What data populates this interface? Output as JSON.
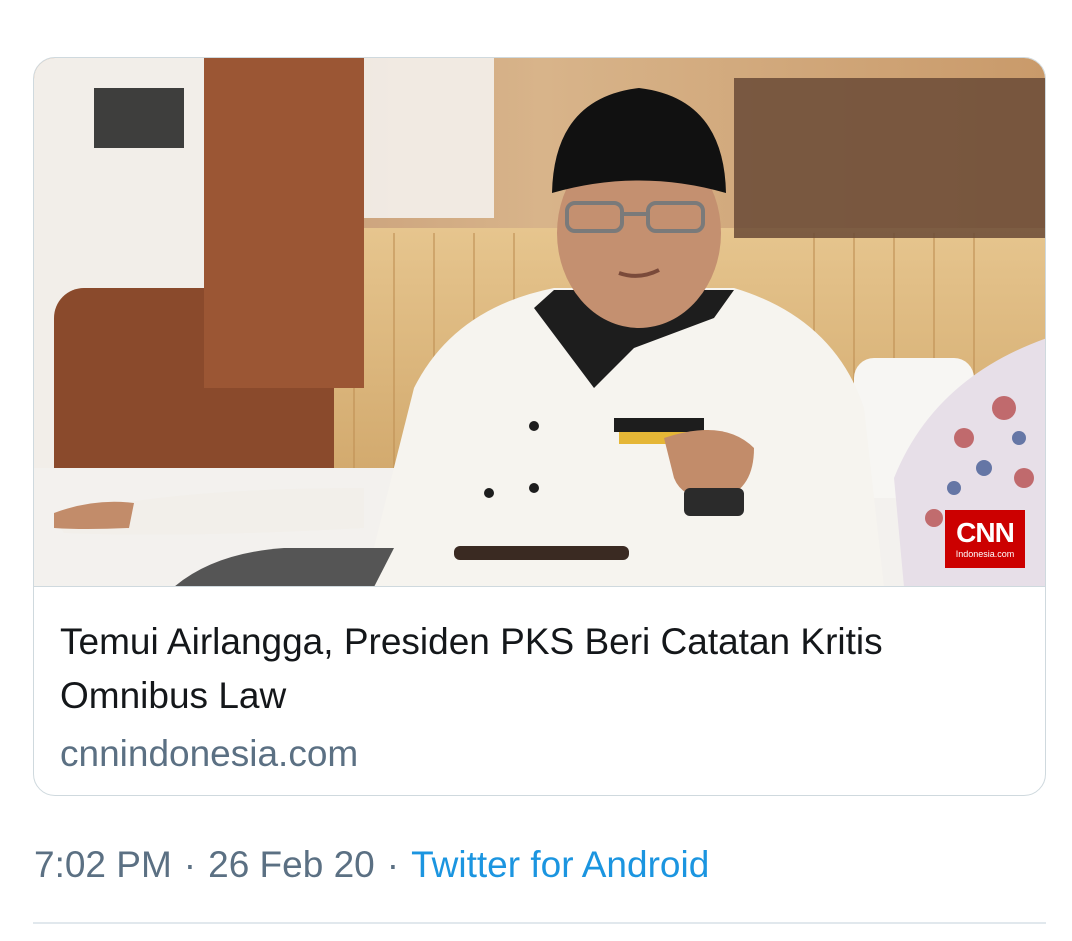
{
  "link_card": {
    "image": {
      "logo_mark": "CNN",
      "logo_subtitle": "Indonesia.com"
    },
    "title": "Temui Airlangga, Presiden PKS Beri Catatan Kritis Omnibus Law",
    "domain": "cnnindonesia.com"
  },
  "tweet_meta": {
    "time": "7:02 PM",
    "separator": "·",
    "date": "26 Feb 20",
    "source": "Twitter for Android"
  },
  "colors": {
    "text_primary": "#14171a",
    "text_secondary": "#5b7083",
    "link": "#1b95e0",
    "border": "#cfd9de",
    "cnn_red": "#cc0000"
  }
}
